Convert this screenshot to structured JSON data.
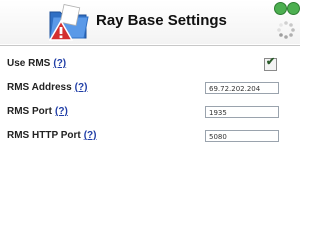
{
  "header": {
    "title": "Ray Base Settings",
    "icon": "folder-warning-icon",
    "window_controls": [
      "close-icon",
      "help-icon"
    ],
    "spinner": "loading-spinner-icon"
  },
  "settings": [
    {
      "label": "Use RMS",
      "help": "(?)",
      "type": "checkbox",
      "checked": true
    },
    {
      "label": "RMS Address",
      "help": "(?)",
      "type": "text",
      "value": "69.72.202.204"
    },
    {
      "label": "RMS Port",
      "help": "(?)",
      "type": "text",
      "value": "1935"
    },
    {
      "label": "RMS HTTP Port",
      "help": "(?)",
      "type": "text",
      "value": "5080"
    }
  ],
  "colors": {
    "link": "#1f3da6",
    "window_controls": "#4caf50",
    "folder": "#3a7bd5",
    "warning": "#d32f2f"
  }
}
